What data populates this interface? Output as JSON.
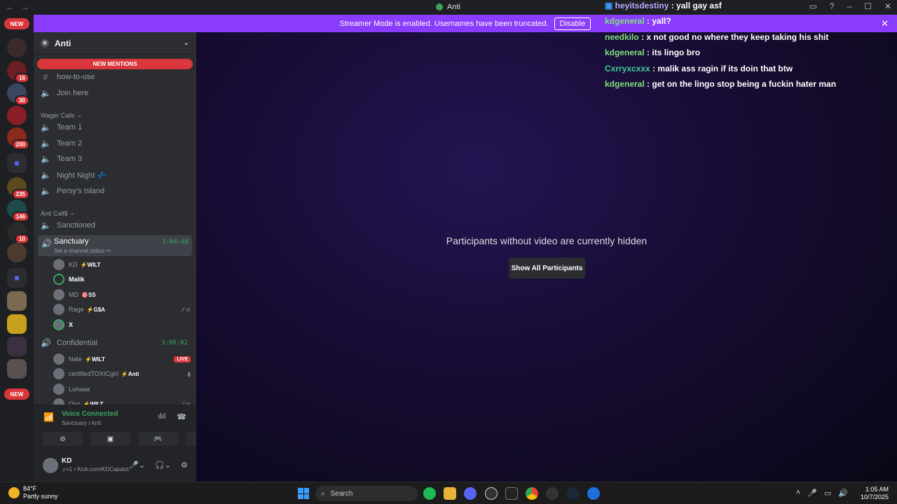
{
  "titlebar": {
    "title": "Anti"
  },
  "banner": {
    "text": "Streamer Mode is enabled. Usernames have been truncated.",
    "disable_label": "Disable"
  },
  "rail": {
    "top_pill": "NEW",
    "bottom_pill": "NEW",
    "badges": [
      "16",
      "30",
      "200",
      "235",
      "146",
      "10"
    ]
  },
  "sidebar": {
    "server_name": "Anti",
    "new_mentions": "NEW MENTIONS",
    "channels_top": [
      {
        "icon": "hash-icon",
        "label": "how-to-use"
      },
      {
        "icon": "speaker-icon",
        "label": "Join here"
      }
    ],
    "category_wager": "Wager Calls",
    "wager_channels": [
      {
        "label": "Team 1"
      },
      {
        "label": "Team 2"
      },
      {
        "label": "Team 3"
      },
      {
        "label": "Night Night 💤"
      },
      {
        "label": "Persy's Island"
      }
    ],
    "category_anti": "Anti Call$",
    "sanctioned": "Sanctioned",
    "sanctuary": {
      "name": "Sanctuary",
      "status": "Set a channel status ✏",
      "time": "1:04:48"
    },
    "sanctuary_users": [
      {
        "name": "KD",
        "tag": "⚡WILT",
        "right": ""
      },
      {
        "name": "Malik",
        "tag": "",
        "right": ""
      },
      {
        "name": "MD",
        "tag": "🎯SS",
        "right": ""
      },
      {
        "name": "Rage",
        "tag": "⚡G$A",
        "right": "⁄⁄ ⊘"
      },
      {
        "name": "X",
        "tag": "",
        "right": ""
      }
    ],
    "confidential": {
      "name": "Confidential",
      "time": "3:08:02"
    },
    "confidential_users": [
      {
        "name": "Nate",
        "tag": "⚡WILT",
        "right": "LIVE"
      },
      {
        "name": "certifiedTOXICgirl",
        "tag": "⚡Anti",
        "right": "▮"
      },
      {
        "name": "Lunaaa",
        "tag": "",
        "right": ""
      },
      {
        "name": "Oso",
        "tag": "⚡WILT",
        "right": "⁄⁄ ⊘"
      }
    ]
  },
  "voice": {
    "status": "Voice Connected",
    "location": "Sanctuary / Anti"
  },
  "user": {
    "name": "KD",
    "status": "♫+1 • Kick.com/KDCapalot"
  },
  "stage": {
    "message": "Participants without video are currently hidden",
    "show_all": "Show All Participants"
  },
  "chat": [
    {
      "user": "heyitsdestiny",
      "text": " : yall gay asf"
    },
    {
      "user": "kdgeneral",
      "text": " : yall?"
    },
    {
      "user": "needkilo",
      "text": " : x not good no where they keep taking his shit"
    },
    {
      "user": "kdgeneral",
      "text": " : its lingo bro"
    },
    {
      "user": "Cxrryxcxxx",
      "text": " : malik ass ragin if its doin that btw"
    },
    {
      "user": "kdgeneral",
      "text": " : get on the lingo stop being a fuckin hater man"
    }
  ],
  "taskbar": {
    "temp": "84°F",
    "weather": "Partly sunny",
    "search": "Search",
    "time": "1:05 AM",
    "date": "10/7/2025"
  }
}
